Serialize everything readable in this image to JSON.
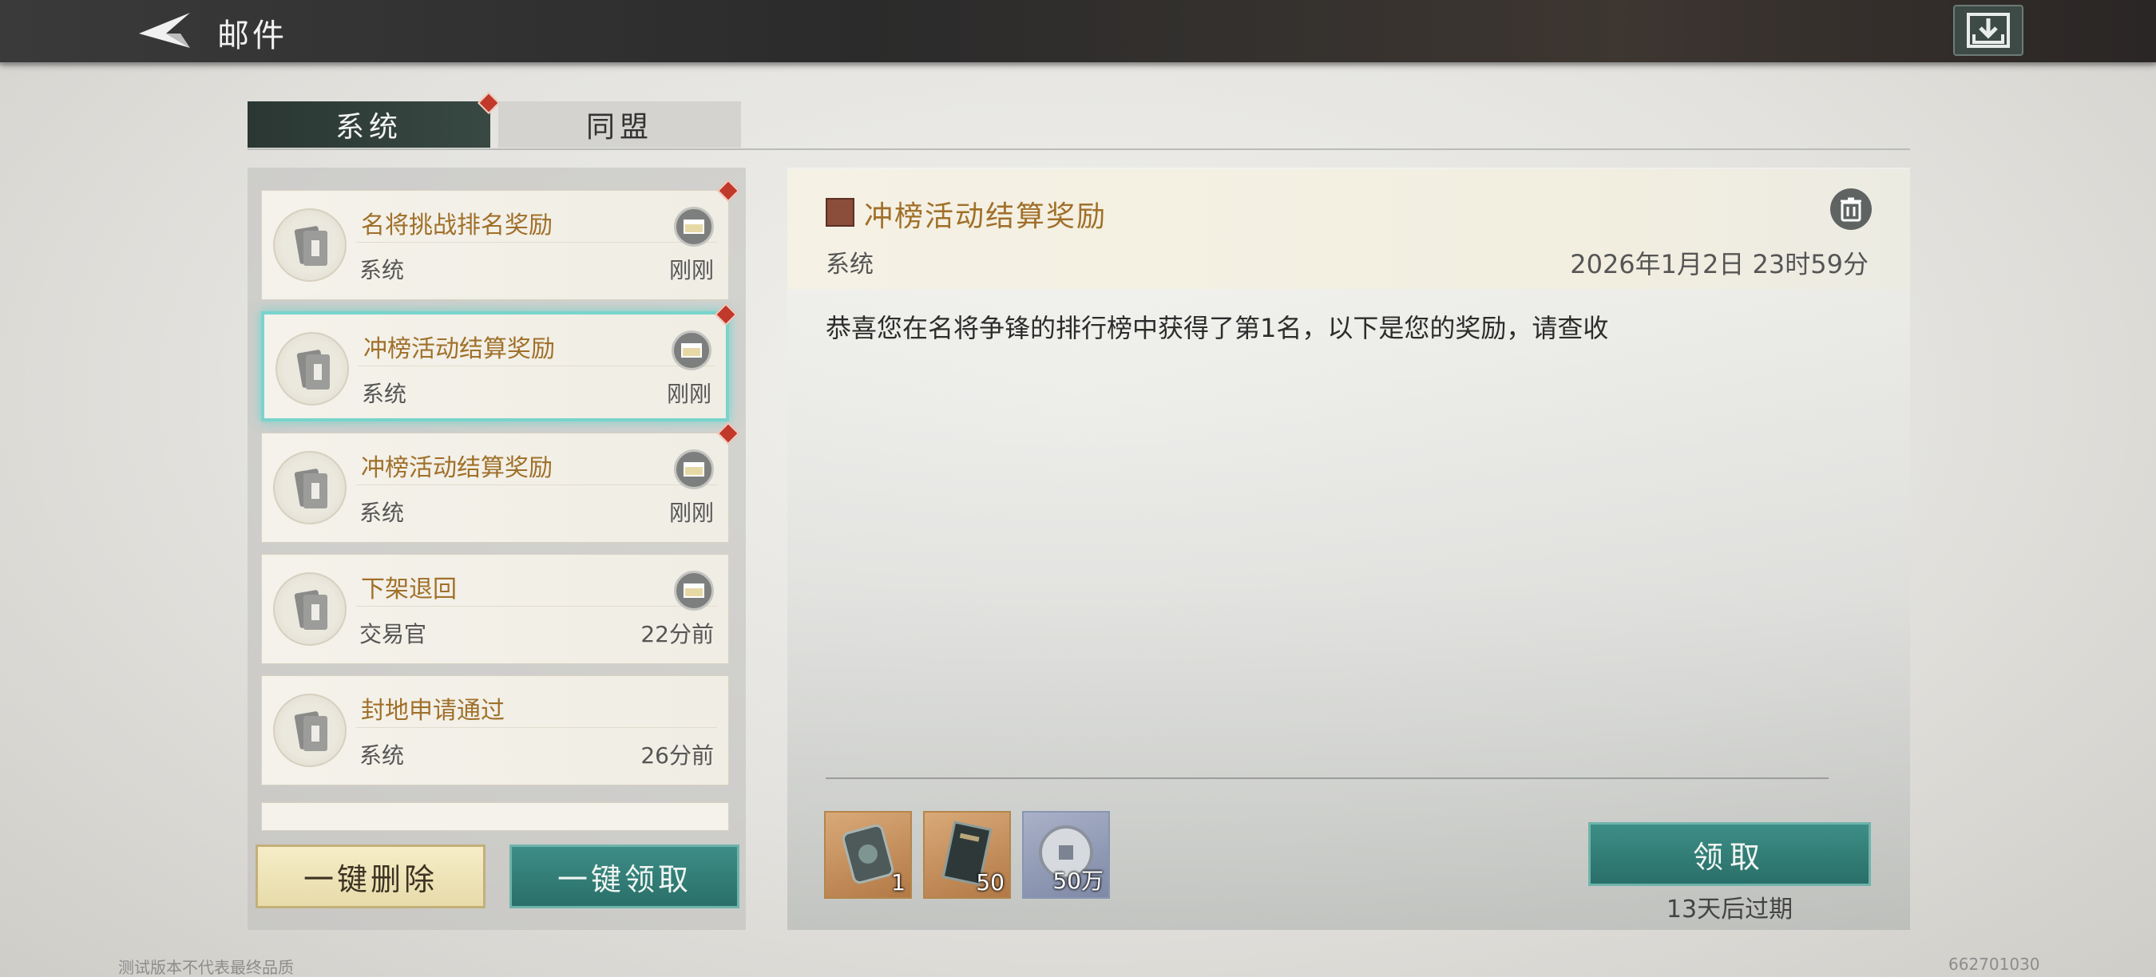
{
  "header": {
    "title": "邮件"
  },
  "tabs": [
    {
      "label": "系统",
      "active": true,
      "has_badge": true
    },
    {
      "label": "同盟",
      "active": false,
      "has_badge": false
    }
  ],
  "mail_list": [
    {
      "title": "名将挑战排名奖励",
      "sender": "系统",
      "time": "刚刚",
      "has_attachment": true,
      "unread": true,
      "selected": false
    },
    {
      "title": "冲榜活动结算奖励",
      "sender": "系统",
      "time": "刚刚",
      "has_attachment": true,
      "unread": true,
      "selected": true
    },
    {
      "title": "冲榜活动结算奖励",
      "sender": "系统",
      "time": "刚刚",
      "has_attachment": true,
      "unread": true,
      "selected": false
    },
    {
      "title": "下架退回",
      "sender": "交易官",
      "time": "22分前",
      "has_attachment": true,
      "unread": false,
      "selected": false
    },
    {
      "title": "封地申请通过",
      "sender": "系统",
      "time": "26分前",
      "has_attachment": false,
      "unread": false,
      "selected": false
    }
  ],
  "list_buttons": {
    "delete_all": "一键删除",
    "claim_all": "一键领取"
  },
  "detail": {
    "title": "冲榜活动结算奖励",
    "sender": "系统",
    "date": "2026年1月2日 23时59分",
    "body": "恭喜您在名将争锋的排行榜中获得了第1名，以下是您的奖励，请查收",
    "rewards": [
      {
        "icon": "token-item-icon",
        "count": "1"
      },
      {
        "icon": "book-item-icon",
        "count": "50"
      },
      {
        "icon": "coin-item-icon",
        "count": "50万"
      }
    ],
    "claim_label": "领取",
    "expire_text": "13天后过期"
  },
  "footer": {
    "disclaimer": "测试版本不代表最终品质",
    "build_id": "662701030"
  },
  "colors": {
    "accent_teal": "#2f7d76",
    "title_gold": "#a0702a",
    "badge_red": "#c0392b",
    "selected_glow": "#79d4cd"
  }
}
